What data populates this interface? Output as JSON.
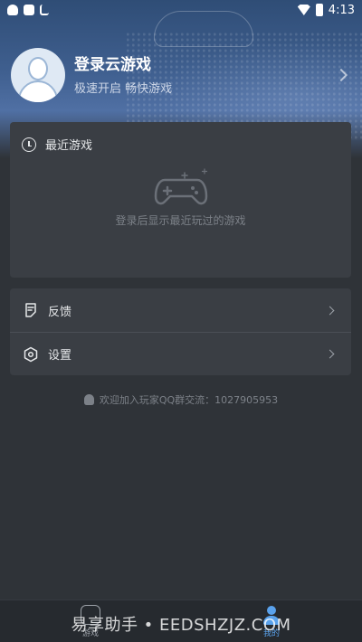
{
  "status_bar": {
    "time": "4:13"
  },
  "profile": {
    "title": "登录云游戏",
    "subtitle": "极速开启 畅快游戏"
  },
  "recent": {
    "title": "最近游戏",
    "empty_text": "登录后显示最近玩过的游戏"
  },
  "menu": {
    "items": [
      {
        "label": "反馈",
        "icon": "feedback-icon"
      },
      {
        "label": "设置",
        "icon": "settings-icon"
      }
    ]
  },
  "qq_group": {
    "text": "欢迎加入玩家QQ群交流：1027905953"
  },
  "bottom_nav": {
    "items": [
      {
        "label": "游戏",
        "icon": "game-icon"
      },
      {
        "label": "我的",
        "icon": "profile-icon"
      }
    ],
    "active": "我的"
  },
  "watermark": {
    "text": "易享助手 • EEDSHZJZ.COM"
  },
  "colors": {
    "accent": "#5aa2ec",
    "background": "#2f3338",
    "card": "#3a3e44"
  }
}
